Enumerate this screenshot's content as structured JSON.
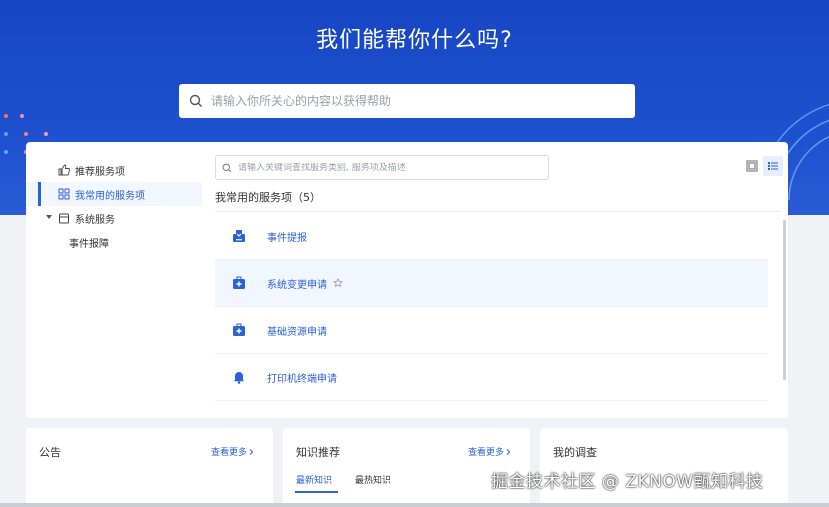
{
  "hero": {
    "title": "我们能帮你什么吗?"
  },
  "search": {
    "placeholder": "请输入你所关心的内容以获得帮助"
  },
  "sidebar": {
    "items": [
      {
        "label": "推荐服务项",
        "icon": "thumbs-up-icon"
      },
      {
        "label": "我常用的服务项",
        "icon": "grid-icon",
        "active": true
      },
      {
        "label": "系统服务",
        "icon": "box-icon",
        "expanded": true
      },
      {
        "label": "事件报障"
      }
    ]
  },
  "content": {
    "search_placeholder": "请输入关键词查找服务类别, 服务项及描述",
    "section_title": "我常用的服务项（5）",
    "services": [
      {
        "name": "事件提报",
        "icon": "download-tray-icon"
      },
      {
        "name": "系统变更申请",
        "icon": "medical-case-icon",
        "favorite_star": true
      },
      {
        "name": "基础资源申请",
        "icon": "medical-case-icon"
      },
      {
        "name": "打印机终端申请",
        "icon": "bell-icon"
      }
    ]
  },
  "cards": {
    "notice": {
      "title": "公告",
      "more": "查看更多"
    },
    "knowledge": {
      "title": "知识推荐",
      "more": "查看更多",
      "tabs": [
        "最新知识",
        "最热知识"
      ]
    },
    "survey": {
      "title": "我的调查"
    }
  },
  "watermark": "掘金技术社区 @ ZKNOW甄知科技",
  "colors": {
    "primary": "#2a62d8",
    "hero_bg": "#1d50cf"
  }
}
